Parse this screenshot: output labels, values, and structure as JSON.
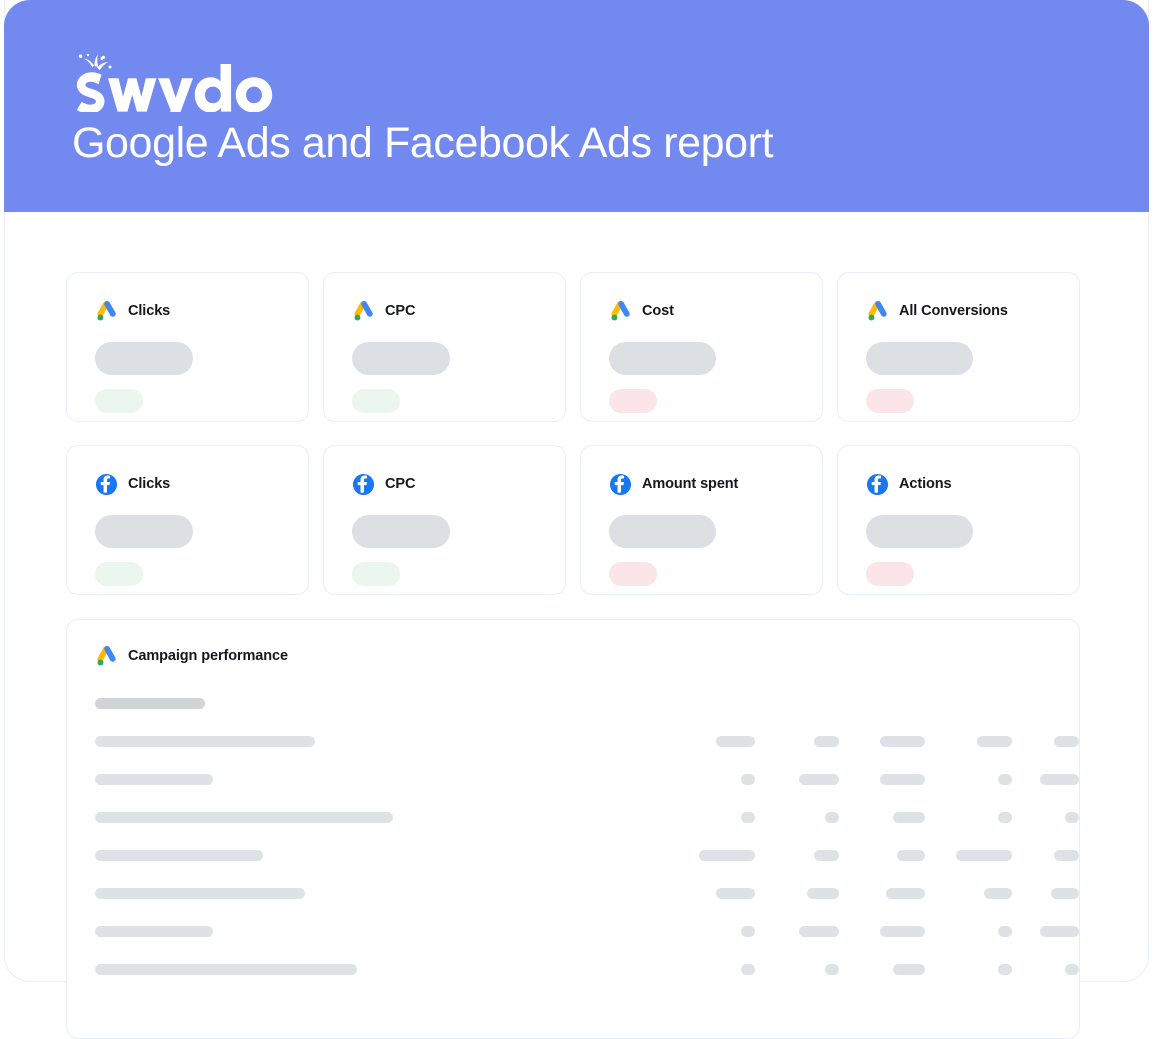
{
  "theme": {
    "header_bg": "#7289F0",
    "card_border": "#E9EDFD",
    "skeleton_gray": "#DEE2E7",
    "skeleton_gray_dark": "#D2D3D5",
    "skeleton_value_gray": "#DCE0E5",
    "delta_up_green": "#EBF6EE",
    "delta_down_red": "#FCE5E8",
    "title_color": "#FFFFFF",
    "label_color": "#16181D"
  },
  "header": {
    "brand_name": "Swydo",
    "brand_icon": "swydo-logo",
    "title": "Google Ads and Facebook Ads report"
  },
  "kpi_rows": [
    {
      "source": "google-ads",
      "icon": "google-ads-icon",
      "cards": [
        {
          "label": "Clicks",
          "value_skeleton_width": 98,
          "delta_skeleton_width": 48,
          "delta_direction": "up"
        },
        {
          "label": "CPC",
          "value_skeleton_width": 98,
          "delta_skeleton_width": 48,
          "delta_direction": "up"
        },
        {
          "label": "Cost",
          "value_skeleton_width": 107,
          "delta_skeleton_width": 48,
          "delta_direction": "down"
        },
        {
          "label": "All Conversions",
          "value_skeleton_width": 107,
          "delta_skeleton_width": 48,
          "delta_direction": "down"
        }
      ]
    },
    {
      "source": "facebook-ads",
      "icon": "facebook-icon",
      "cards": [
        {
          "label": "Clicks",
          "value_skeleton_width": 98,
          "delta_skeleton_width": 48,
          "delta_direction": "up"
        },
        {
          "label": "CPC",
          "value_skeleton_width": 98,
          "delta_skeleton_width": 48,
          "delta_direction": "up"
        },
        {
          "label": "Amount spent",
          "value_skeleton_width": 107,
          "delta_skeleton_width": 48,
          "delta_direction": "down"
        },
        {
          "label": "Actions",
          "value_skeleton_width": 107,
          "delta_skeleton_width": 48,
          "delta_direction": "down"
        }
      ]
    }
  ],
  "table": {
    "icon": "google-ads-icon",
    "title": "Campaign performance",
    "caption_skeleton_width": 110,
    "column_right_edges": [
      660,
      744,
      830,
      917,
      984
    ],
    "rows": [
      {
        "label_width": 220,
        "metric_widths": [
          39,
          25,
          45,
          35,
          25
        ]
      },
      {
        "label_width": 118,
        "metric_widths": [
          14,
          40,
          45,
          14,
          39
        ]
      },
      {
        "label_width": 298,
        "metric_widths": [
          14,
          14,
          32,
          14,
          14
        ]
      },
      {
        "label_width": 168,
        "metric_widths": [
          56,
          25,
          28,
          56,
          25
        ]
      },
      {
        "label_width": 210,
        "metric_widths": [
          39,
          32,
          39,
          28,
          28
        ]
      },
      {
        "label_width": 118,
        "metric_widths": [
          14,
          40,
          45,
          14,
          39
        ]
      },
      {
        "label_width": 262,
        "metric_widths": [
          14,
          14,
          32,
          14,
          14
        ]
      }
    ]
  }
}
